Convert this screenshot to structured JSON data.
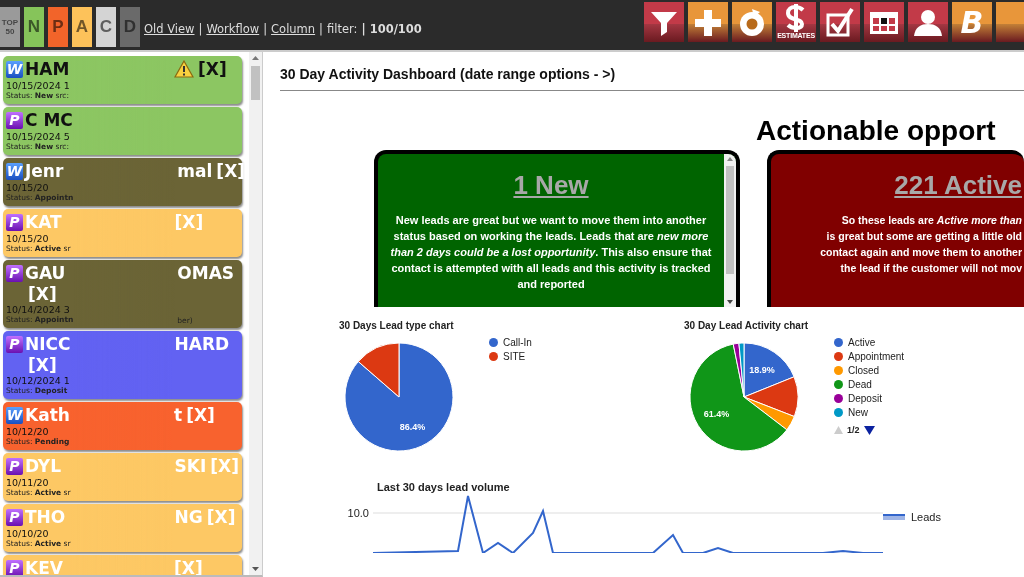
{
  "toolbar": {
    "filters": [
      {
        "label": "TOP 50",
        "color": "#9a9a9a"
      },
      {
        "label": "N",
        "color": "#86c45a"
      },
      {
        "label": "P",
        "color": "#f2642a"
      },
      {
        "label": "A",
        "color": "#fdc25a"
      },
      {
        "label": "C",
        "color": "#d4d4d4"
      },
      {
        "label": "D",
        "color": "#6a6a6a"
      }
    ],
    "links": [
      {
        "label": "Old View",
        "separator": "|"
      },
      {
        "label": "Workflow",
        "separator": "|"
      },
      {
        "label": "Column",
        "separator": "|"
      }
    ],
    "filter_label": "filter:",
    "filter_value": "| 100/100",
    "actions": [
      {
        "kind": "filter",
        "color": "#c23a48"
      },
      {
        "kind": "plus",
        "color": "#e8963a"
      },
      {
        "kind": "refresh",
        "color": "#e8963a"
      },
      {
        "kind": "dollar",
        "color": "#c23a48",
        "label": "ESTIMATES"
      },
      {
        "kind": "check",
        "color": "#c23a48"
      },
      {
        "kind": "grid",
        "color": "#c23a48"
      },
      {
        "kind": "user",
        "color": "#c23a48"
      },
      {
        "kind": "letter",
        "color": "#e8963a",
        "label": "B"
      },
      {
        "kind": "blank",
        "color": "#e8963a"
      }
    ]
  },
  "leads": [
    {
      "source": "W",
      "name_start": "HAM",
      "warning": true,
      "close": "[X]",
      "close_below": false,
      "date": "10/15/2024 1",
      "status": "Status: **New** src:",
      "color": "#8cc662",
      "kind": "dark-title"
    },
    {
      "source": "P",
      "name_start": "C MC",
      "warning": false,
      "date": "10/15/2024 5",
      "status": "Status: **New** src:",
      "color": "#8cc662",
      "kind": "dark-title"
    },
    {
      "source": "W",
      "name_start": "Jenr",
      "name_end": "mal",
      "warning": false,
      "close": "[X]",
      "close_below": false,
      "date": "10/15/20",
      "status": "Status: **Appointn**",
      "color": "#6b6436",
      "kind": "light-title"
    },
    {
      "source": "P",
      "name_start": "KAT",
      "warning": false,
      "close": "[X]",
      "close_below": false,
      "date": "10/15/20",
      "status": "Status: **Active** sr",
      "color": "#fdc864",
      "kind": "light-title"
    },
    {
      "source": "P",
      "name_start": "GAU",
      "name_end": "OMAS",
      "warning": false,
      "close": "[X]",
      "close_below": true,
      "date": "10/14/2024 3",
      "status": "Status: **Appointn**",
      "status_end": "ber)",
      "color": "#6b6436",
      "kind": "light-title"
    },
    {
      "source": "P",
      "name_start": "NICC",
      "name_end": "HARD",
      "warning": false,
      "close": "[X]",
      "close_below": true,
      "date": "10/12/2024 1",
      "status": "Status: **Deposit**",
      "color": "#6262f2",
      "kind": "light-title"
    },
    {
      "source": "W",
      "name_start": "Kath",
      "name_end": "t",
      "warning": false,
      "close": "[X]",
      "close_below": false,
      "date": "10/12/20",
      "status": "Status: **Pending**",
      "color": "#f8622e",
      "kind": "light-title"
    },
    {
      "source": "P",
      "name_start": "DYL",
      "name_end": "SKI",
      "warning": false,
      "close": "[X]",
      "close_below": false,
      "date": "10/11/20",
      "status": "Status: **Active** sr",
      "color": "#fdc864",
      "kind": "light-title"
    },
    {
      "source": "P",
      "name_start": "THO",
      "name_end": "NG",
      "warning": false,
      "close": "[X]",
      "close_below": false,
      "date": "10/10/20",
      "status": "Status: **Active** sr",
      "color": "#fdc864",
      "kind": "light-title"
    },
    {
      "source": "P",
      "name_start": "KEV",
      "warning": false,
      "close": "[X]",
      "close_below": false,
      "color": "#fdc864",
      "kind": "light-title"
    }
  ],
  "dashboard": {
    "title": "30 Day Activity Dashboard (date range options - >)",
    "heading": "Actionable opport",
    "cards": [
      {
        "heading": "1 New",
        "color": "#006400",
        "scrollable": true,
        "lines": [
          "New leads are great but we want to move them into another status based on working the leads. Leads that are *new more than 2 days could be a lost opportunity*. This also ensure that contact is attempted with all leads and this activity is tracked and reported"
        ]
      },
      {
        "heading": "221 Active",
        "color": "#800000",
        "scrollable": false,
        "lines": [
          "So these leads are *Active more than*",
          "is great but some are getting a little old",
          "contact again and move them to another",
          "the lead if the customer will not mov"
        ]
      }
    ],
    "charts": [
      {
        "chart_data": {
          "type": "pie",
          "title": "30 Days Lead type chart",
          "categories": [
            "Call-In",
            "SITE"
          ],
          "values": [
            86.4,
            13.6
          ],
          "colors": [
            "#3366cc",
            "#dc3912"
          ],
          "value_labels": [
            "86.4%",
            null
          ]
        }
      },
      {
        "chart_data": {
          "type": "pie",
          "title": "30 Day Lead Activity chart",
          "categories": [
            "Active",
            "Appointment",
            "Closed",
            "Dead",
            "Deposit",
            "New"
          ],
          "values": [
            18.9,
            12.0,
            4.5,
            61.4,
            1.7,
            1.5
          ],
          "colors": [
            "#3366cc",
            "#dc3912",
            "#ff9900",
            "#109618",
            "#990099",
            "#0099c6"
          ],
          "value_labels": [
            "18.9%",
            null,
            null,
            "61.4%",
            null,
            null
          ]
        },
        "legend_page": "1/2"
      }
    ],
    "volume": {
      "title": "Last 30 days lead volume",
      "ytick": "10.0",
      "legend": "Leads"
    }
  }
}
